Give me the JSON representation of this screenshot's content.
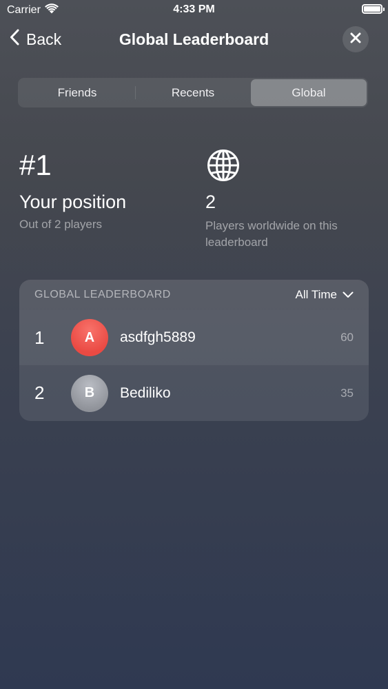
{
  "status_bar": {
    "carrier": "Carrier",
    "time": "4:33 PM"
  },
  "nav": {
    "back_label": "Back",
    "title": "Global Leaderboard"
  },
  "tabs": [
    {
      "label": "Friends",
      "selected": false
    },
    {
      "label": "Recents",
      "selected": false
    },
    {
      "label": "Global",
      "selected": true
    }
  ],
  "stats": {
    "rank": "#1",
    "position_label": "Your position",
    "position_sub": "Out of 2 players",
    "player_count": "2",
    "player_count_sub": "Players worldwide on this leaderboard"
  },
  "leaderboard": {
    "header_title": "GLOBAL LEADERBOARD",
    "filter_label": "All Time",
    "rows": [
      {
        "rank": "1",
        "initial": "A",
        "name": "asdfgh5889",
        "score": "60",
        "avatar_color": "#ef5750"
      },
      {
        "rank": "2",
        "initial": "B",
        "name": "Bediliko",
        "score": "35",
        "avatar_color": "#9fa2a9"
      }
    ]
  },
  "colors": {
    "background_top": "#4d5057",
    "background_bottom": "#2f3951"
  }
}
